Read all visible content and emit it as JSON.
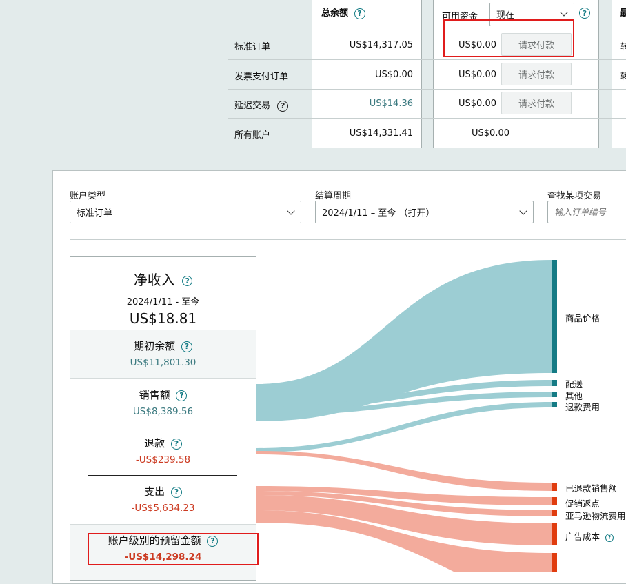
{
  "summary": {
    "col_total": "总余额",
    "col_available": "可用资金",
    "available_select": "现在",
    "col_third": "最",
    "request_label": "请求付款",
    "rows": [
      {
        "label": "标准订单",
        "total": "US$14,317.05",
        "available": "US$0.00",
        "third": "转"
      },
      {
        "label": "发票支付订单",
        "total": "US$0.00",
        "available": "US$0.00",
        "third": "转"
      },
      {
        "label": "延迟交易",
        "total": "US$14.36",
        "available": "US$0.00",
        "third": ""
      },
      {
        "label": "所有账户",
        "total": "US$14,331.41",
        "available": "US$0.00",
        "third": ""
      }
    ]
  },
  "filters": {
    "account_type_label": "账户类型",
    "account_type_value": "标准订单",
    "period_label": "结算周期",
    "period_value": "2024/1/11 – 至今 （打开）",
    "search_label": "查找某项交易",
    "search_placeholder": "输入订单编号"
  },
  "summary_panel": {
    "net_title": "净收入",
    "net_date": "2024/1/11 - 至今",
    "net_value": "US$18.81",
    "opening_title": "期初余额",
    "opening_value": "US$11,801.30",
    "sales_title": "销售额",
    "sales_value": "US$8,389.56",
    "refund_title": "退款",
    "refund_value": "-US$239.58",
    "expense_title": "支出",
    "expense_value": "-US$5,634.23",
    "reserve_title": "账户级别的预留金额",
    "reserve_value": "-US$14,298.24"
  },
  "flow_labels": {
    "product_price": "商品价格",
    "shipping": "配送",
    "other": "其他",
    "refund_fee": "退款费用",
    "refunded_sales": "已退款销售额",
    "promo_rebate": "促销返点",
    "amazon_logistics": "亚马逊物流费用",
    "ad_cost": "广告成本"
  },
  "colors": {
    "teal_flow": "#9ccdd3",
    "teal_bar": "#157b85",
    "red_flow": "#f3ab9c",
    "red_bar": "#e03c0f",
    "highlight": "#e01c1c"
  }
}
